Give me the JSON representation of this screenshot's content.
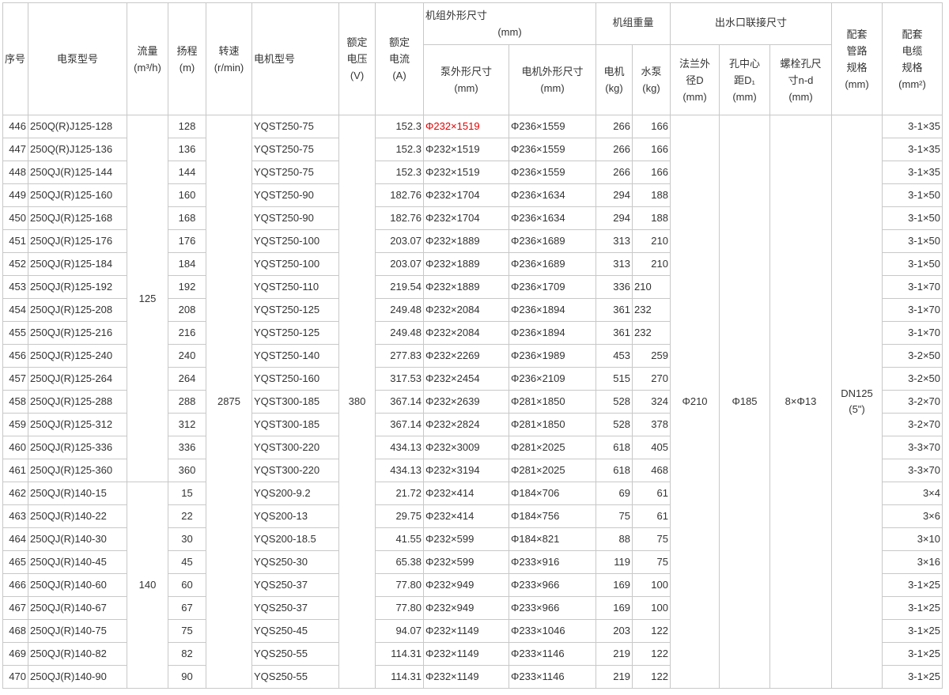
{
  "headers": {
    "index": "序号",
    "pump_model": "电泵型号",
    "flow": "流量",
    "flow_unit": "(m³/h)",
    "head": "扬程",
    "head_unit": "(m)",
    "speed": "转速",
    "speed_unit": "(r/min)",
    "motor_model": "电机型号",
    "voltage": "额定电压",
    "voltage_unit": "(V)",
    "current": "额定电流",
    "current_unit": "(A)",
    "dims": "机组外形尺寸",
    "dims_unit": "(mm)",
    "pump_dims": "泵外形尺寸",
    "pump_dims_unit": "(mm)",
    "motor_dims": "电机外形尺寸",
    "motor_dims_unit": "(mm)",
    "weight": "机组重量",
    "weight_motor": "电机",
    "weight_motor_unit": "(kg)",
    "weight_pump": "水泵",
    "weight_pump_unit": "(kg)",
    "outlet": "出水口联接尺寸",
    "flange": "法兰外径D",
    "flange_unit": "(mm)",
    "hole_dist": "孔中心距D₁",
    "hole_dist_unit": "(mm)",
    "bolt": "螺栓孔尺寸n-d",
    "bolt_unit": "(mm)",
    "pipe": "配套管路规格",
    "pipe_unit": "(mm)",
    "cable": "配套电缆规格",
    "cable_unit": "(mm²)"
  },
  "groups": {
    "flow_a": "125",
    "flow_b": "140",
    "speed": "2875",
    "voltage": "380",
    "flange": "Φ210",
    "hole_dist": "Φ185",
    "bolt": "8×Φ13",
    "pipe": "DN125",
    "pipe_inch": "(5\")"
  },
  "rows": [
    {
      "no": "446",
      "model": "250Q(R)J125-128",
      "head": "128",
      "motor": "YQST250-75",
      "current": "152.3",
      "pump": "Φ232×1519",
      "mdim": "Φ236×1559",
      "wm": "266",
      "wp": "166",
      "cable": "3-1×35",
      "pump_red": true
    },
    {
      "no": "447",
      "model": "250Q(R)J125-136",
      "head": "136",
      "motor": "YQST250-75",
      "current": "152.3",
      "pump": "Φ232×1519",
      "mdim": "Φ236×1559",
      "wm": "266",
      "wp": "166",
      "cable": "3-1×35"
    },
    {
      "no": "448",
      "model": "250QJ(R)125-144",
      "head": "144",
      "motor": "YQST250-75",
      "current": "152.3",
      "pump": "Φ232×1519",
      "mdim": "Φ236×1559",
      "wm": "266",
      "wp": "166",
      "cable": "3-1×35"
    },
    {
      "no": "449",
      "model": "250QJ(R)125-160",
      "head": "160",
      "motor": "YQST250-90",
      "current": "182.76",
      "pump": "Φ232×1704",
      "mdim": "Φ236×1634",
      "wm": "294",
      "wp": "188",
      "cable": "3-1×50"
    },
    {
      "no": "450",
      "model": "250QJ(R)125-168",
      "head": "168",
      "motor": "YQST250-90",
      "current": "182.76",
      "pump": "Φ232×1704",
      "mdim": "Φ236×1634",
      "wm": "294",
      "wp": "188",
      "cable": "3-1×50"
    },
    {
      "no": "451",
      "model": "250QJ(R)125-176",
      "head": "176",
      "motor": "YQST250-100",
      "current": "203.07",
      "pump": "Φ232×1889",
      "mdim": "Φ236×1689",
      "wm": "313",
      "wp": "210",
      "cable": "3-1×50"
    },
    {
      "no": "452",
      "model": "250QJ(R)125-184",
      "head": "184",
      "motor": "YQST250-100",
      "current": "203.07",
      "pump": "Φ232×1889",
      "mdim": "Φ236×1689",
      "wm": "313",
      "wp": "210",
      "cable": "3-1×50"
    },
    {
      "no": "453",
      "model": "250QJ(R)125-192",
      "head": "192",
      "motor": "YQST250-110",
      "current": "219.54",
      "pump": "Φ232×1889",
      "mdim": "Φ236×1709",
      "wm": "336",
      "wp": "210",
      "cable": "3-1×70",
      "wp_left": true
    },
    {
      "no": "454",
      "model": "250QJ(R)125-208",
      "head": "208",
      "motor": "YQST250-125",
      "current": "249.48",
      "pump": "Φ232×2084",
      "mdim": "Φ236×1894",
      "wm": "361",
      "wp": "232",
      "cable": "3-1×70",
      "wp_left": true
    },
    {
      "no": "455",
      "model": "250QJ(R)125-216",
      "head": "216",
      "motor": "YQST250-125",
      "current": "249.48",
      "pump": "Φ232×2084",
      "mdim": "Φ236×1894",
      "wm": "361",
      "wp": "232",
      "cable": "3-1×70",
      "wp_left": true
    },
    {
      "no": "456",
      "model": "250QJ(R)125-240",
      "head": "240",
      "motor": "YQST250-140",
      "current": "277.83",
      "pump": "Φ232×2269",
      "mdim": "Φ236×1989",
      "wm": "453",
      "wp": "259",
      "cable": "3-2×50"
    },
    {
      "no": "457",
      "model": "250QJ(R)125-264",
      "head": "264",
      "motor": "YQST250-160",
      "current": "317.53",
      "pump": "Φ232×2454",
      "mdim": "Φ236×2109",
      "wm": "515",
      "wp": "270",
      "cable": "3-2×50"
    },
    {
      "no": "458",
      "model": "250QJ(R)125-288",
      "head": "288",
      "motor": "YQST300-185",
      "current": "367.14",
      "pump": "Φ232×2639",
      "mdim": "Φ281×1850",
      "wm": "528",
      "wp": "324",
      "cable": "3-2×70"
    },
    {
      "no": "459",
      "model": "250QJ(R)125-312",
      "head": "312",
      "motor": "YQST300-185",
      "current": "367.14",
      "pump": "Φ232×2824",
      "mdim": "Φ281×1850",
      "wm": "528",
      "wp": "378",
      "cable": "3-2×70"
    },
    {
      "no": "460",
      "model": "250QJ(R)125-336",
      "head": "336",
      "motor": "YQST300-220",
      "current": "434.13",
      "pump": "Φ232×3009",
      "mdim": "Φ281×2025",
      "wm": "618",
      "wp": "405",
      "cable": "3-3×70"
    },
    {
      "no": "461",
      "model": "250QJ(R)125-360",
      "head": "360",
      "motor": "YQST300-220",
      "current": "434.13",
      "pump": "Φ232×3194",
      "mdim": "Φ281×2025",
      "wm": "618",
      "wp": "468",
      "cable": "3-3×70"
    },
    {
      "no": "462",
      "model": "250QJ(R)140-15",
      "head": "15",
      "motor": "YQS200-9.2",
      "current": "21.72",
      "pump": "Φ232×414",
      "mdim": "Φ184×706",
      "wm": "69",
      "wp": "61",
      "cable": "3×4"
    },
    {
      "no": "463",
      "model": "250QJ(R)140-22",
      "head": "22",
      "motor": "YQS200-13",
      "current": "29.75",
      "pump": "Φ232×414",
      "mdim": "Φ184×756",
      "wm": "75",
      "wp": "61",
      "cable": "3×6"
    },
    {
      "no": "464",
      "model": "250QJ(R)140-30",
      "head": "30",
      "motor": "YQS200-18.5",
      "current": "41.55",
      "pump": "Φ232×599",
      "mdim": "Φ184×821",
      "wm": "88",
      "wp": "75",
      "cable": "3×10"
    },
    {
      "no": "465",
      "model": "250QJ(R)140-45",
      "head": "45",
      "motor": "YQS250-30",
      "current": "65.38",
      "pump": "Φ232×599",
      "mdim": "Φ233×916",
      "wm": "119",
      "wp": "75",
      "cable": "3×16"
    },
    {
      "no": "466",
      "model": "250QJ(R)140-60",
      "head": "60",
      "motor": "YQS250-37",
      "current": "77.80",
      "pump": "Φ232×949",
      "mdim": "Φ233×966",
      "wm": "169",
      "wp": "100",
      "cable": "3-1×25"
    },
    {
      "no": "467",
      "model": "250QJ(R)140-67",
      "head": "67",
      "motor": "YQS250-37",
      "current": "77.80",
      "pump": "Φ232×949",
      "mdim": "Φ233×966",
      "wm": "169",
      "wp": "100",
      "cable": "3-1×25"
    },
    {
      "no": "468",
      "model": "250QJ(R)140-75",
      "head": "75",
      "motor": "YQS250-45",
      "current": "94.07",
      "pump": "Φ232×1149",
      "mdim": "Φ233×1046",
      "wm": "203",
      "wp": "122",
      "cable": "3-1×25"
    },
    {
      "no": "469",
      "model": "250QJ(R)140-82",
      "head": "82",
      "motor": "YQS250-55",
      "current": "114.31",
      "pump": "Φ232×1149",
      "mdim": "Φ233×1146",
      "wm": "219",
      "wp": "122",
      "cable": "3-1×25"
    },
    {
      "no": "470",
      "model": "250QJ(R)140-90",
      "head": "90",
      "motor": "YQS250-55",
      "current": "114.31",
      "pump": "Φ232×1149",
      "mdim": "Φ233×1146",
      "wm": "219",
      "wp": "122",
      "cable": "3-1×25"
    }
  ]
}
